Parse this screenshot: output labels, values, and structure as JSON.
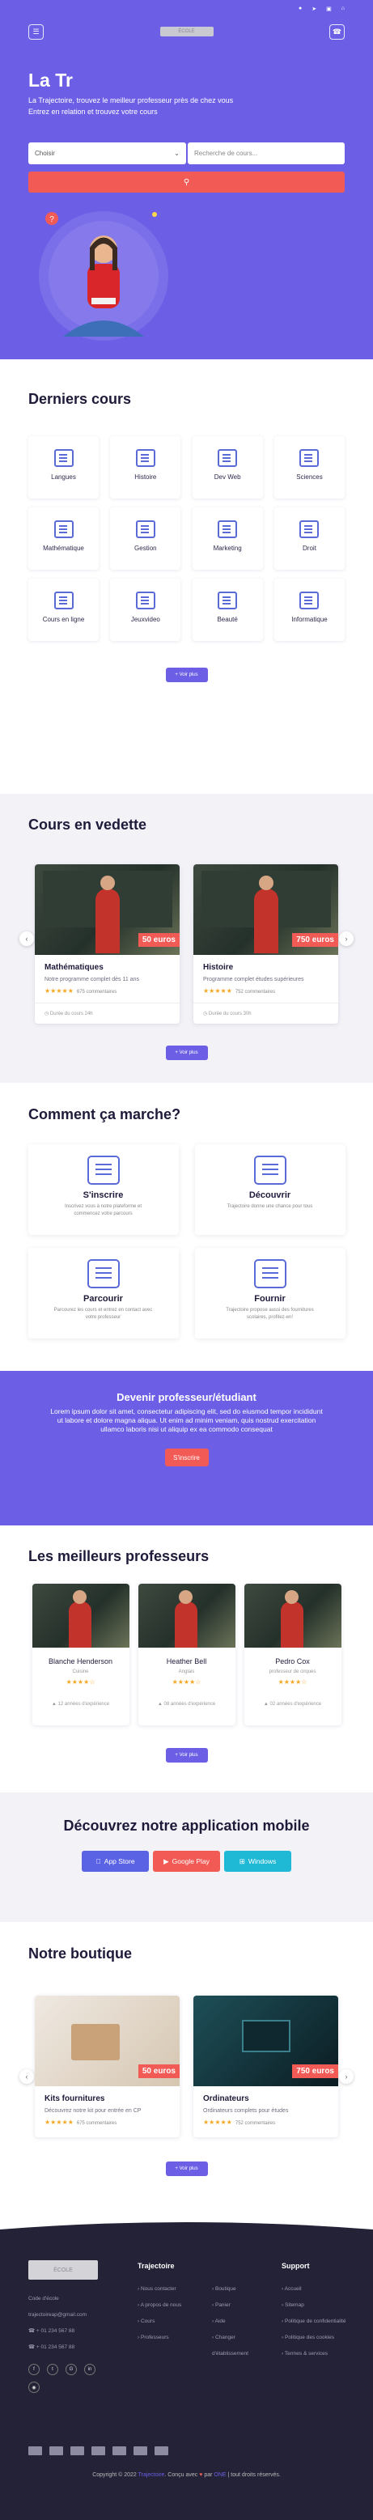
{
  "header": {
    "logo_label": "ÉCOLE",
    "icons": [
      "user-icon",
      "language-icon",
      "cart-icon",
      "home-icon"
    ]
  },
  "hero": {
    "title": "La Tr",
    "subtitle_line1": "La Trajectoire, trouvez le meilleur professeur près de chez vous",
    "subtitle_line2": "Entrez en relation et trouvez votre cours",
    "select_value": "Choisir",
    "search_placeholder": "Recherche de cours...",
    "question_mark": "?"
  },
  "latest": {
    "title": "Derniers cours",
    "categories": [
      "Langues",
      "Histoire",
      "Dev Web",
      "Sciences",
      "Mathématique",
      "Gestion",
      "Marketing",
      "Droit",
      "Cours en ligne",
      "Jeuxvideo",
      "Beauté",
      "Informatique"
    ],
    "more": "+ Voir plus"
  },
  "featured": {
    "title": "Cours en vedette",
    "cards": [
      {
        "title": "Mathématiques",
        "desc": "Notre programme complet dès 11 ans",
        "stars": "★★★★★",
        "count": "675 commentaires",
        "duration": "Durée du cours 24h",
        "price": "50 euros"
      },
      {
        "title": "Histoire",
        "desc": "Programme complet études supérieures",
        "stars": "★★★★★",
        "count": "752 commentaires",
        "duration": "Durée du cours 30h",
        "price": "750 euros"
      }
    ],
    "more": "+ Voir plus"
  },
  "how": {
    "title": "Comment ça marche?",
    "items": [
      {
        "title": "S'inscrire",
        "desc": "Inscrivez vous à notre plateforme et commencez votre parcours"
      },
      {
        "title": "Découvrir",
        "desc": "Trajectoire donne une chance pour tous"
      },
      {
        "title": "Parcourir",
        "desc": "Parcourez les cours et entrez en contact avec votre professeur"
      },
      {
        "title": "Fournir",
        "desc": "Trajectoire propose aussi des fournitures scolaires, profitez-en!"
      }
    ]
  },
  "become": {
    "title": "Devenir professeur/étudiant",
    "text": "Lorem ipsum dolor sit amet, consectetur adipiscing elit, sed do eiusmod tempor incididunt ut labore et dolore magna aliqua. Ut enim ad minim veniam, quis nostrud exercitation ullamco laboris nisi ut aliquip ex ea commodo consequat",
    "button": "S'inscrire"
  },
  "teachers": {
    "title": "Les meilleurs professeurs",
    "items": [
      {
        "name": "Blanche Henderson",
        "subject": "Cuisine",
        "stars": "★★★★☆",
        "exp": "12 années d'expérience"
      },
      {
        "name": "Heather Bell",
        "subject": "Anglais",
        "stars": "★★★★☆",
        "exp": "08 années d'expérience"
      },
      {
        "name": "Pedro Cox",
        "subject": "professeur de cirques",
        "stars": "★★★★☆",
        "exp": "02 années d'expérience"
      }
    ],
    "more": "+ Voir plus"
  },
  "app": {
    "title": "Découvrez notre application mobile",
    "buttons": [
      {
        "label": "App Store",
        "color": "#5b63e5"
      },
      {
        "label": "Google Play",
        "color": "#f25a55"
      },
      {
        "label": "Windows",
        "color": "#1fb9d6"
      }
    ]
  },
  "shop": {
    "title": "Notre boutique",
    "cards": [
      {
        "title": "Kits fournitures",
        "desc": "Découvrez notre kit pour entrée en CP",
        "stars": "★★★★★",
        "count": "675 commentaires",
        "price": "50 euros"
      },
      {
        "title": "Ordinateurs",
        "desc": "Ordinateurs complets pour études",
        "stars": "★★★★★",
        "count": "752 commentaires",
        "price": "750 euros"
      }
    ],
    "more": "+ Voir plus"
  },
  "footer": {
    "logo_label": "ÉCOLE",
    "address": "Code d'école",
    "email": "trajectoireap@gmail.com",
    "phone1": "+ 01 234 567 88",
    "phone2": "+ 01 234 567 88",
    "col2_title": "Trajectoire",
    "col2_links_a": [
      "Nous contacter",
      "A propos de nous",
      "Cours",
      "Professeurs"
    ],
    "col2_links_b": [
      "Boutique",
      "Panier",
      "Aide",
      "Changer d'établissement"
    ],
    "col3_title": "Support",
    "col3_links": [
      "Accueil",
      "Sitemap",
      "Politique de confidentialité",
      "Politique des cookies",
      "Termes & services"
    ],
    "copyright_pre": "Copyright © 2022",
    "brand": "Trajectoire",
    "copyright_mid": ". Conçu avec",
    "heart": "♥",
    "copyright_by": "par",
    "author": "ONE",
    "copyright_post": "| tout droits réservés."
  },
  "colors": {
    "primary": "#6c5fe6",
    "accent": "#f25a55",
    "dark": "#232236"
  }
}
